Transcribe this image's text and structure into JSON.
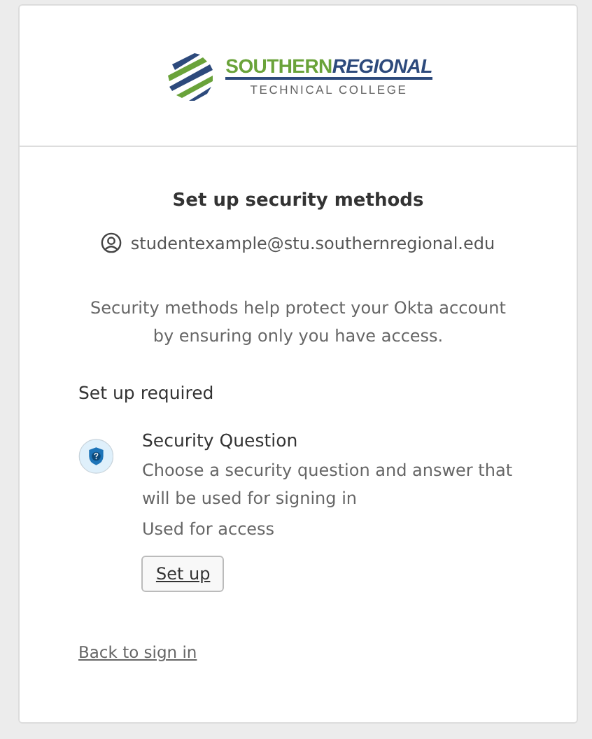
{
  "logo": {
    "name_first": "SOUTHERN",
    "name_second": "REGIONAL",
    "subtitle": "TECHNICAL COLLEGE"
  },
  "title": "Set up security methods",
  "account": "studentexample@stu.southernregional.edu",
  "description": "Security methods help protect your Okta account by ensuring only you have access.",
  "section_title": "Set up required",
  "methods": [
    {
      "name": "Security Question",
      "description": "Choose a security question and answer that will be used for signing in",
      "usage": "Used for access",
      "button": "Set up"
    }
  ],
  "back_link": "Back to sign in"
}
